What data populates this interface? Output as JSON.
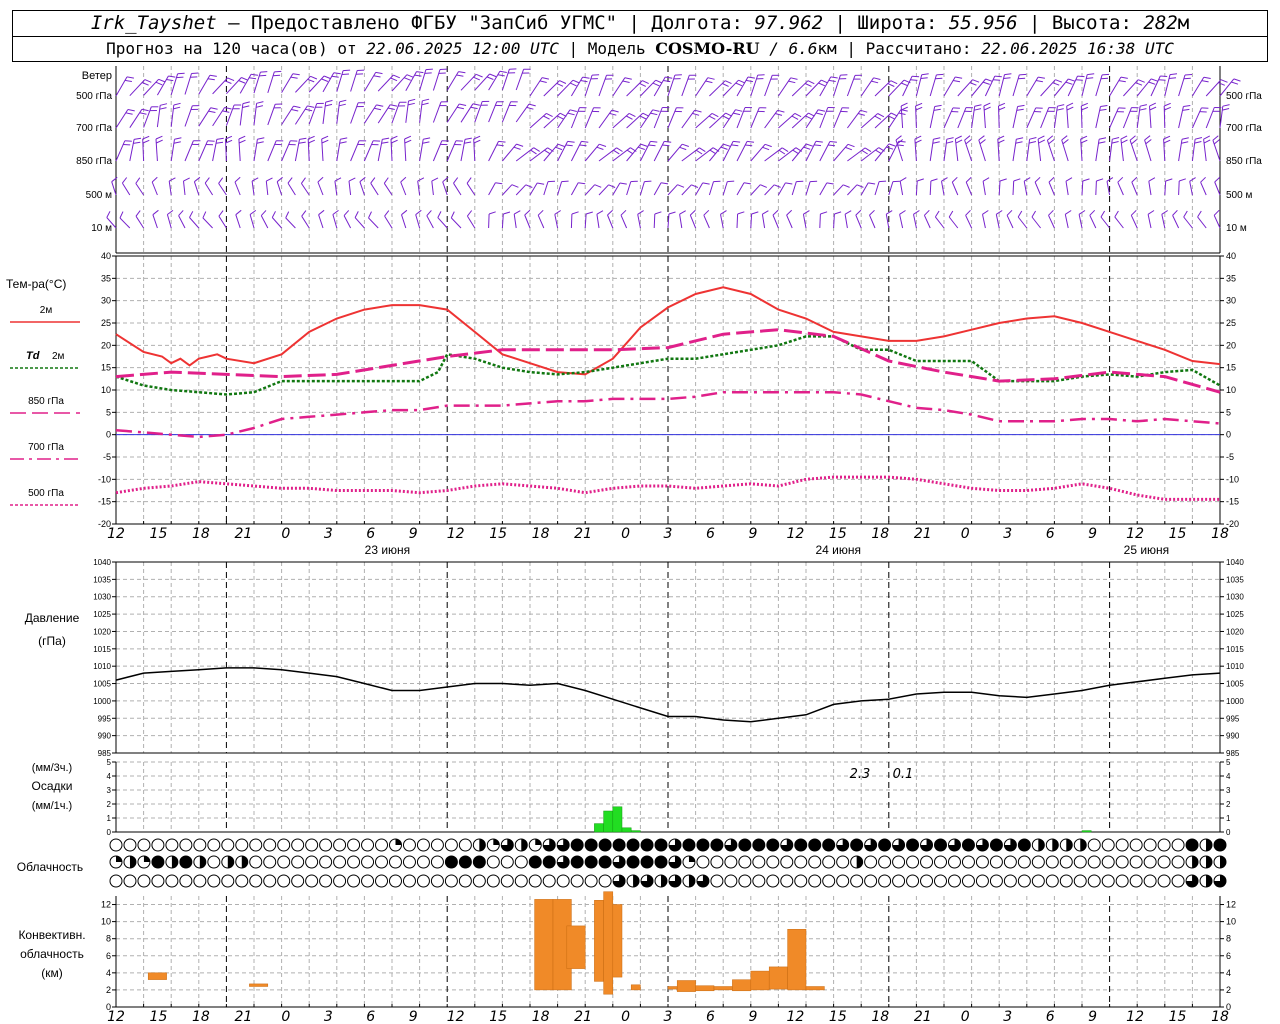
{
  "header": {
    "station": "Irk_Tayshet",
    "provider": "— Предоставлено ФГБУ \"ЗапСиб УГМС\"",
    "lon_label": "| Долгота:",
    "lon": "97.962",
    "lat_label": "| Широта:",
    "lat": "55.956",
    "alt_label": "| Высота:",
    "alt": "282",
    "alt_unit": "м",
    "forecast_label": "Прогноз на 120 часа(ов) от",
    "forecast_start": "22.06.2025 12:00 UTC",
    "model_label": "| Модель",
    "model_name": "COSMO-RU",
    "model_res": "/ 6.6",
    "model_res_unit": "км",
    "calc_label": "| Рассчитано:",
    "calc_time": "22.06.2025 16:38 UTC"
  },
  "colors": {
    "t2m": "#ee3333",
    "td2m": "#117711",
    "t850": "#e0208a",
    "t700": "#e0208a",
    "t500": "#e0208a",
    "wind": "#7722cc",
    "precip": "#22dd22",
    "conv": "#f08a28",
    "pressure": "#000000",
    "zero_line": "#3333dd"
  },
  "panels": {
    "wind": {
      "title": "Ветер",
      "levels": [
        "500 гПа",
        "700 гПа",
        "850 гПа",
        "500 м",
        "10 м"
      ]
    },
    "temperature": {
      "title": "Тем-ра(°С)",
      "legend": [
        {
          "label": "2м",
          "style": "solid",
          "color": "#ee3333"
        },
        {
          "label_it": "Td",
          "label": "2м",
          "style": "dotted",
          "color": "#117711"
        },
        {
          "label": "850 гПа",
          "style": "dashed",
          "color": "#e0208a"
        },
        {
          "label": "700 гПа",
          "style": "dashdot",
          "color": "#e0208a"
        },
        {
          "label": "500 гПа",
          "style": "dotted",
          "color": "#e0208a"
        }
      ],
      "y_ticks": [
        "40",
        "35",
        "30",
        "25",
        "20",
        "15",
        "10",
        "5",
        "0",
        "-5",
        "-10",
        "-15",
        "-20"
      ]
    },
    "pressure": {
      "title1": "Давление",
      "title2": "(гПа)",
      "y_ticks": [
        "1040",
        "1035",
        "1030",
        "1025",
        "1020",
        "1015",
        "1010",
        "1005",
        "1000",
        "995",
        "990",
        "985"
      ]
    },
    "precip": {
      "title1": "(мм/3ч.)",
      "title2": "Осадки",
      "title3": "(мм/1ч.)",
      "y_ticks": [
        "5",
        "4",
        "3",
        "2",
        "1",
        "0"
      ],
      "labels": [
        "2.3",
        "0.1"
      ]
    },
    "cloud": {
      "title": "Облачность"
    },
    "conv": {
      "title1": "Конвективн.",
      "title2": "облачность",
      "title3": "(км)",
      "y_ticks": [
        "12",
        "10",
        "8",
        "6",
        "4",
        "2",
        "0"
      ]
    }
  },
  "time_axis": {
    "tick_labels": [
      "12",
      "15",
      "18",
      "21",
      "0",
      "3",
      "6",
      "9",
      "12",
      "15",
      "18",
      "21",
      "0",
      "3",
      "6",
      "9",
      "12",
      "15",
      "18",
      "21",
      "0",
      "3",
      "6",
      "9",
      "12",
      "15",
      "18"
    ],
    "dates": [
      "23 июня",
      "24 июня",
      "25 июня"
    ]
  },
  "chart_data": [
    {
      "type": "line",
      "title": "Тем-ра(°С)",
      "x_hours": "hours since 22.06.2025 12:00 UTC",
      "ylim": [
        -20,
        40
      ],
      "series": [
        {
          "name": "2м",
          "x": [
            0,
            3,
            5,
            6,
            7,
            8,
            9,
            10,
            11,
            12,
            15,
            18,
            21,
            24,
            27,
            30,
            33,
            36,
            39,
            42,
            45,
            48,
            51,
            54,
            57,
            60,
            63,
            66,
            69,
            72,
            75,
            78,
            81,
            84,
            87,
            90,
            93,
            96,
            99,
            102,
            105,
            108,
            111,
            114,
            117,
            120
          ],
          "values": [
            22.5,
            18.5,
            17.5,
            16,
            17,
            15.5,
            17,
            17.5,
            18,
            17,
            16,
            18,
            23,
            26,
            28,
            29,
            29,
            28,
            23,
            18,
            16,
            14,
            13.5,
            17,
            24,
            28.5,
            31.5,
            33,
            31.5,
            28,
            26,
            23,
            22,
            21,
            21,
            22,
            23.5,
            25,
            26,
            26.5,
            25,
            23,
            21,
            19,
            16.5,
            15.8
          ]
        },
        {
          "name": "Td 2м",
          "x": [
            0,
            3,
            6,
            9,
            12,
            15,
            18,
            21,
            24,
            27,
            30,
            33,
            35,
            36,
            39,
            42,
            45,
            48,
            51,
            54,
            57,
            60,
            63,
            66,
            69,
            72,
            75,
            78,
            81,
            84,
            87,
            90,
            93,
            96,
            99,
            102,
            105,
            108,
            111,
            114,
            117,
            120
          ],
          "values": [
            13,
            11,
            10,
            9.5,
            9,
            9.5,
            12,
            12,
            12,
            12,
            12,
            12,
            14,
            18,
            17,
            15,
            14,
            13.5,
            14,
            15,
            16,
            17,
            17,
            18,
            19,
            20,
            22,
            22,
            19,
            19,
            16.5,
            16.5,
            16.5,
            12,
            12,
            12,
            13,
            13.5,
            13,
            14,
            14.5,
            11
          ]
        },
        {
          "name": "850 гПа",
          "x": [
            0,
            6,
            12,
            18,
            24,
            30,
            36,
            42,
            48,
            54,
            60,
            66,
            72,
            78,
            84,
            90,
            96,
            102,
            108,
            114,
            120
          ],
          "values": [
            13,
            14,
            13.5,
            13,
            13.5,
            15.5,
            17.5,
            19,
            19,
            19,
            19.5,
            22.5,
            23.5,
            22,
            16.5,
            14,
            12,
            12.5,
            14,
            13,
            9.5
          ]
        },
        {
          "name": "700 гПа",
          "x": [
            0,
            3,
            6,
            9,
            12,
            15,
            18,
            21,
            24,
            27,
            30,
            33,
            36,
            39,
            42,
            45,
            48,
            51,
            54,
            57,
            60,
            63,
            66,
            69,
            72,
            75,
            78,
            81,
            84,
            87,
            90,
            93,
            96,
            99,
            102,
            105,
            108,
            111,
            114,
            117,
            120
          ],
          "values": [
            1,
            0.5,
            0,
            -0.5,
            0,
            1.5,
            3.5,
            4,
            4.5,
            5,
            5.5,
            5.5,
            6.5,
            6.5,
            6.5,
            7,
            7.5,
            7.5,
            8,
            8,
            8,
            8.5,
            9.5,
            9.5,
            9.5,
            9.5,
            9.5,
            9,
            7.5,
            6,
            5.5,
            4.5,
            3,
            3,
            3,
            3.5,
            3.5,
            3,
            3.5,
            3,
            2.5
          ]
        },
        {
          "name": "500 гПа",
          "x": [
            0,
            3,
            6,
            9,
            12,
            15,
            18,
            21,
            24,
            27,
            30,
            33,
            36,
            39,
            42,
            45,
            48,
            51,
            54,
            57,
            60,
            63,
            66,
            69,
            72,
            75,
            78,
            81,
            84,
            87,
            90,
            93,
            96,
            99,
            102,
            105,
            108,
            111,
            114,
            117,
            120
          ],
          "values": [
            -13,
            -12,
            -11.5,
            -10.5,
            -11,
            -11.5,
            -12,
            -12,
            -12.5,
            -12.5,
            -12.5,
            -13,
            -12.5,
            -11.5,
            -11,
            -11.5,
            -12,
            -13,
            -12,
            -11.5,
            -11.5,
            -12,
            -11.5,
            -11,
            -11.5,
            -10,
            -9.5,
            -9.5,
            -9.5,
            -10,
            -11,
            -12,
            -12.5,
            -12.5,
            -12,
            -11,
            -12,
            -13.5,
            -14.5,
            -14.5,
            -14.5
          ]
        }
      ]
    },
    {
      "type": "line",
      "title": "Давление (гПа)",
      "ylim": [
        985,
        1040
      ],
      "series": [
        {
          "name": "pressure",
          "x": [
            0,
            3,
            6,
            9,
            12,
            15,
            18,
            21,
            24,
            27,
            30,
            33,
            36,
            39,
            42,
            45,
            48,
            51,
            54,
            57,
            60,
            63,
            66,
            69,
            72,
            75,
            78,
            81,
            84,
            87,
            90,
            93,
            96,
            99,
            102,
            105,
            108,
            111,
            114,
            117,
            120
          ],
          "values": [
            1006,
            1008,
            1008.5,
            1009,
            1009.5,
            1009.5,
            1009,
            1008,
            1007,
            1005,
            1003,
            1003,
            1004,
            1005,
            1005,
            1004.5,
            1005,
            1003,
            1000.5,
            998,
            995.5,
            995.5,
            994.5,
            994,
            995,
            996,
            999,
            1000,
            1000.5,
            1002,
            1002.5,
            1002.5,
            1001.5,
            1001,
            1002,
            1003,
            1004.5,
            1005.5,
            1006.5,
            1007.5,
            1008
          ]
        }
      ]
    },
    {
      "type": "bar",
      "title": "Осадки",
      "ylim": [
        0,
        5
      ],
      "bars": [
        {
          "x": 52.5,
          "value": 0.6
        },
        {
          "x": 53.5,
          "value": 1.5
        },
        {
          "x": 54.5,
          "value": 1.8
        },
        {
          "x": 55.5,
          "value": 0.3
        },
        {
          "x": 56.5,
          "value": 0.1
        },
        {
          "x": 105.5,
          "value": 0.1
        }
      ]
    },
    {
      "type": "bar",
      "title": "Конвективн. облачность (км)",
      "ylim": [
        0,
        13
      ],
      "bars": [
        {
          "x0": 3.5,
          "x1": 5.5,
          "bottom": 3.2,
          "top": 4
        },
        {
          "x0": 14.5,
          "x1": 16.5,
          "bottom": 2.4,
          "top": 2.7
        },
        {
          "x0": 45.5,
          "x1": 47.5,
          "bottom": 2,
          "top": 12.6
        },
        {
          "x0": 47.5,
          "x1": 49.5,
          "bottom": 2,
          "top": 12.6
        },
        {
          "x0": 49,
          "x1": 51,
          "bottom": 4.5,
          "top": 9.5
        },
        {
          "x0": 52,
          "x1": 53,
          "bottom": 3,
          "top": 12.5
        },
        {
          "x0": 53,
          "x1": 54,
          "bottom": 1.5,
          "top": 13.5
        },
        {
          "x0": 54,
          "x1": 55,
          "bottom": 3.5,
          "top": 12
        },
        {
          "x0": 56,
          "x1": 57,
          "bottom": 2,
          "top": 2.6
        },
        {
          "x0": 60,
          "x1": 61,
          "bottom": 2.1,
          "top": 2.4
        },
        {
          "x0": 61,
          "x1": 63,
          "bottom": 1.8,
          "top": 3.1
        },
        {
          "x0": 63,
          "x1": 65,
          "bottom": 1.9,
          "top": 2.5
        },
        {
          "x0": 65,
          "x1": 67,
          "bottom": 2,
          "top": 2.4
        },
        {
          "x0": 67,
          "x1": 69,
          "bottom": 1.9,
          "top": 3.2
        },
        {
          "x0": 69,
          "x1": 71,
          "bottom": 2,
          "top": 4.2
        },
        {
          "x0": 71,
          "x1": 73,
          "bottom": 2.1,
          "top": 4.7
        },
        {
          "x0": 73,
          "x1": 75,
          "bottom": 2,
          "top": 9.1
        },
        {
          "x0": 75,
          "x1": 77,
          "bottom": 2,
          "top": 2.4
        }
      ]
    }
  ]
}
